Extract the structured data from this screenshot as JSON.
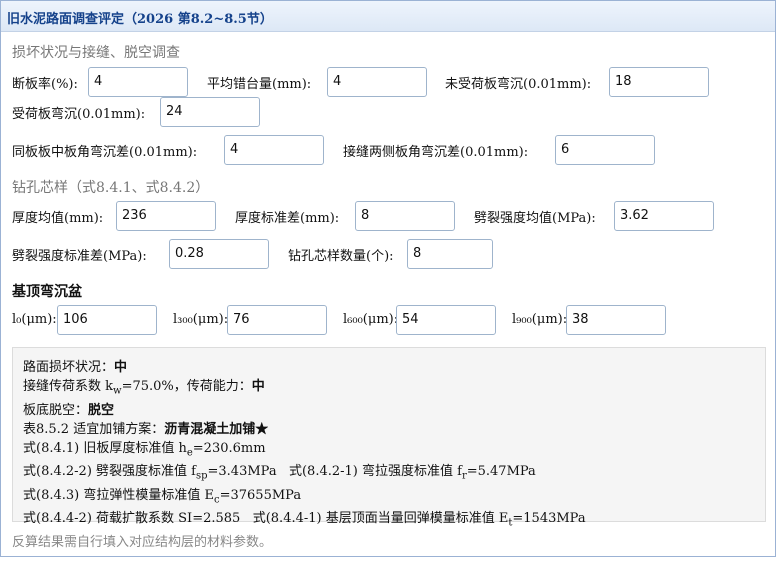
{
  "title": "旧水泥路面调查评定（2026 第8.2~8.5节）",
  "section1": {
    "title": "损坏状况与接缝、脱空调查",
    "fields": {
      "duanban": {
        "label": "断板率(%):",
        "value": "4"
      },
      "cuotai": {
        "label": "平均错台量(mm):",
        "value": "4"
      },
      "weishouhe": {
        "label": "未受荷板弯沉(0.01mm):",
        "value": "18"
      },
      "shouhe": {
        "label": "受荷板弯沉(0.01mm):",
        "value": "24"
      },
      "tongban": {
        "label": "同板板中板角弯沉差(0.01mm):",
        "value": "4"
      },
      "jiefeng": {
        "label": "接缝两侧板角弯沉差(0.01mm):",
        "value": "6"
      }
    }
  },
  "section2": {
    "title": "钻孔芯样（式8.4.1、式8.4.2）",
    "fields": {
      "houdu_mean": {
        "label": "厚度均值(mm):",
        "value": "236"
      },
      "houdu_std": {
        "label": "厚度标准差(mm):",
        "value": "8"
      },
      "pilie_mean": {
        "label": "劈裂强度均值(MPa):",
        "value": "3.62"
      },
      "pilie_std": {
        "label": "劈裂强度标准差(MPa):",
        "value": "0.28"
      },
      "count": {
        "label": "钻孔芯样数量(个):",
        "value": "8"
      }
    }
  },
  "section3": {
    "title": "基顶弯沉盆",
    "fields": {
      "l0": {
        "label": "l₀(μm):",
        "value": "106"
      },
      "l300": {
        "label": "l₃₀₀(μm):",
        "value": "76"
      },
      "l600": {
        "label": "l₆₀₀(μm):",
        "value": "54"
      },
      "l900": {
        "label": "l₉₀₀(μm):",
        "value": "38"
      }
    }
  },
  "result": {
    "damage_label": "路面损坏状况：",
    "damage_value": "中",
    "kw_prefix": "接缝传荷系数 k",
    "kw_sub": "w",
    "kw_mid": "=75.0%，传荷能力：",
    "kw_value": "中",
    "void_label": "板底脱空：",
    "void_value": "脱空",
    "plan_label": "表8.5.2 适宜加铺方案：",
    "plan_value": "沥青混凝土加铺★",
    "he_prefix": "式(8.4.1) 旧板厚度标准值 h",
    "he_sub": "e",
    "he_value": "=230.6mm",
    "fsp_prefix": "式(8.4.2-2) 劈裂强度标准值 f",
    "fsp_sub": "sp",
    "fsp_value": "=3.43MPa",
    "fr_prefix": "式(8.4.2-1) 弯拉强度标准值 f",
    "fr_sub": "r",
    "fr_value": "=5.47MPa",
    "ec_prefix": "式(8.4.3) 弯拉弹性模量标准值 E",
    "ec_sub": "c",
    "ec_value": "=37655MPa",
    "si_text": "式(8.4.4-2) 荷载扩散系数 SI=2.585",
    "et_prefix": "式(8.4.4-1) 基层顶面当量回弹模量标准值 E",
    "et_sub": "t",
    "et_value": "=1543MPa"
  },
  "note": "反算结果需自行填入对应结构层的材料参数。"
}
